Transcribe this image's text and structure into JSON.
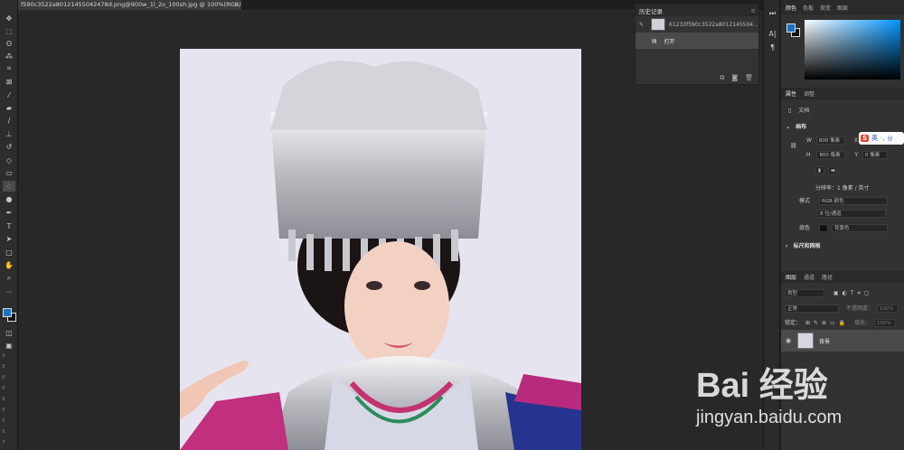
{
  "document": {
    "tab_title": "f590c3522a80121455042478d.png@900w_1l_2o_100sh.jpg @ 100%(RGB/8#)",
    "close": "×"
  },
  "toolbar": {
    "tools": [
      "move-tool-icon",
      "marquee-tool-icon",
      "lasso-tool-icon",
      "quick-select-tool-icon",
      "crop-tool-icon",
      "frame-tool-icon",
      "eyedropper-tool-icon",
      "healing-brush-icon",
      "brush-tool-icon",
      "clone-stamp-icon",
      "history-brush-icon",
      "eraser-tool-icon",
      "gradient-tool-icon",
      "blur-tool-icon",
      "dodge-tool-icon",
      "pen-tool-icon",
      "type-tool-icon",
      "path-select-icon",
      "rectangle-tool-icon",
      "hand-tool-icon",
      "zoom-tool-icon",
      "more-tools-icon"
    ],
    "ruler_numbers": [
      "0",
      "5",
      "0",
      "0",
      "6",
      "5",
      "0",
      "0",
      "7",
      "5",
      "0"
    ]
  },
  "history_panel": {
    "title": "历史记录",
    "snapshot_label": "61233f590c3522a8012145504...",
    "items": [
      {
        "label": "打开"
      }
    ]
  },
  "color_panel": {
    "tabs": [
      "颜色",
      "色板",
      "渐变",
      "图案"
    ],
    "foreground": "#1a72c4",
    "background": "#111111"
  },
  "properties_panel": {
    "tabs": [
      "属性",
      "调整"
    ],
    "doc_label": "文档",
    "canvas_section": "画布",
    "w_label": "W",
    "w_value": "800 像素",
    "h_label": "H",
    "h_value": "800 像素",
    "x_label": "X",
    "y_label": "Y",
    "y_value": "0 像素",
    "resolution": "分辨率：1 像素 / 英寸",
    "mode_label": "模式",
    "mode_value": "RGB 颜色",
    "depth_value": "8 位/通道",
    "fill_label": "填色",
    "fill_value": "背景色",
    "rulers_section": "标尺和网格"
  },
  "layers_panel": {
    "tabs": [
      "图层",
      "通道",
      "路径"
    ],
    "filter_value": "类型",
    "blend_value": "正常",
    "opacity_label": "不透明度：",
    "opacity_value": "100%",
    "lock_label": "锁定：",
    "fill_label": "填充：",
    "fill_value": "100%",
    "layer_name": "背景"
  },
  "ime": {
    "label": "英"
  },
  "watermark": {
    "main": "Bai 经验",
    "url": "jingyan.baidu.com"
  }
}
